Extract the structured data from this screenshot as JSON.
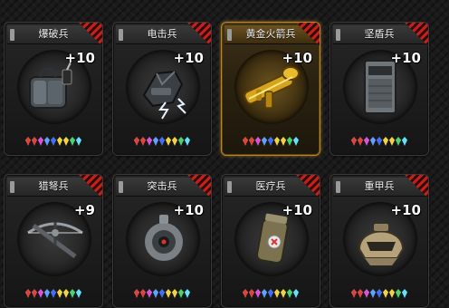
{
  "cards": [
    {
      "name": "爆破兵",
      "level": "+10",
      "item_icon": "explosives-bag-icon",
      "selected": false
    },
    {
      "name": "电击兵",
      "level": "+10",
      "item_icon": "electric-gauntlet-icon",
      "selected": false
    },
    {
      "name": "黄金火箭兵",
      "level": "+10",
      "item_icon": "golden-rocket-launcher-icon",
      "selected": true
    },
    {
      "name": "坚盾兵",
      "level": "+10",
      "item_icon": "riot-shield-icon",
      "selected": false
    },
    {
      "name": "猎弩兵",
      "level": "+9",
      "item_icon": "crossbow-icon",
      "selected": false
    },
    {
      "name": "突击兵",
      "level": "+10",
      "item_icon": "scope-drone-icon",
      "selected": false
    },
    {
      "name": "医疗兵",
      "level": "+10",
      "item_icon": "medkit-canister-icon",
      "selected": false
    },
    {
      "name": "重甲兵",
      "level": "+10",
      "item_icon": "heavy-helmet-icon",
      "selected": false
    }
  ],
  "gem_colors": [
    "#e0413a",
    "#e0413a",
    "#d94fd8",
    "#5aa0ff",
    "#3c6cff",
    "#f2d23a",
    "#f2d23a",
    "#3fd46a",
    "#5ee0ff"
  ],
  "colors": {
    "selected_border": "#b8862e",
    "corner_stripe": "#c42018"
  }
}
